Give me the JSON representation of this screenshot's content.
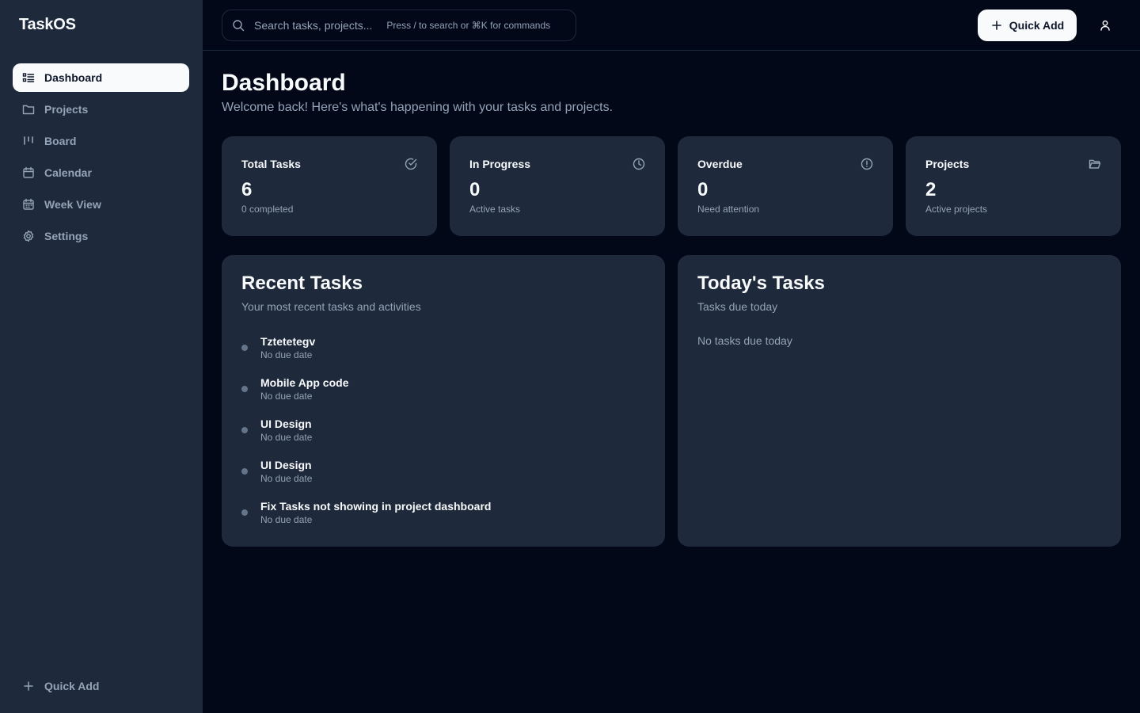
{
  "app": {
    "name": "TaskOS"
  },
  "sidebar": {
    "items": [
      {
        "label": "Dashboard",
        "icon": "dashboard-icon",
        "active": true
      },
      {
        "label": "Projects",
        "icon": "folder-icon"
      },
      {
        "label": "Board",
        "icon": "kanban-icon"
      },
      {
        "label": "Calendar",
        "icon": "calendar-icon"
      },
      {
        "label": "Week View",
        "icon": "calendar-week-icon"
      },
      {
        "label": "Settings",
        "icon": "gear-icon"
      }
    ],
    "quick_add_label": "Quick Add"
  },
  "topbar": {
    "search_placeholder": "Search tasks, projects...",
    "search_hint": "Press / to search or ⌘K for commands",
    "quick_add_label": "Quick Add"
  },
  "page": {
    "title": "Dashboard",
    "subtitle": "Welcome back! Here's what's happening with your tasks and projects."
  },
  "stats": [
    {
      "label": "Total Tasks",
      "value": "6",
      "desc": "0 completed",
      "icon": "check-circle-icon"
    },
    {
      "label": "In Progress",
      "value": "0",
      "desc": "Active tasks",
      "icon": "clock-icon"
    },
    {
      "label": "Overdue",
      "value": "0",
      "desc": "Need attention",
      "icon": "alert-circle-icon"
    },
    {
      "label": "Projects",
      "value": "2",
      "desc": "Active projects",
      "icon": "folder-open-icon"
    }
  ],
  "recent": {
    "title": "Recent Tasks",
    "subtitle": "Your most recent tasks and activities",
    "tasks": [
      {
        "name": "Tztetetegv",
        "due": "No due date"
      },
      {
        "name": "Mobile App code",
        "due": "No due date"
      },
      {
        "name": "UI Design",
        "due": "No due date"
      },
      {
        "name": "UI Design",
        "due": "No due date"
      },
      {
        "name": "Fix Tasks not showing in project dashboard",
        "due": "No due date"
      }
    ]
  },
  "today": {
    "title": "Today's Tasks",
    "subtitle": "Tasks due today",
    "empty": "No tasks due today"
  },
  "colors": {
    "background": "#020817",
    "card": "#1e293b",
    "text": "#f8fafc",
    "muted": "#94a3b8"
  }
}
